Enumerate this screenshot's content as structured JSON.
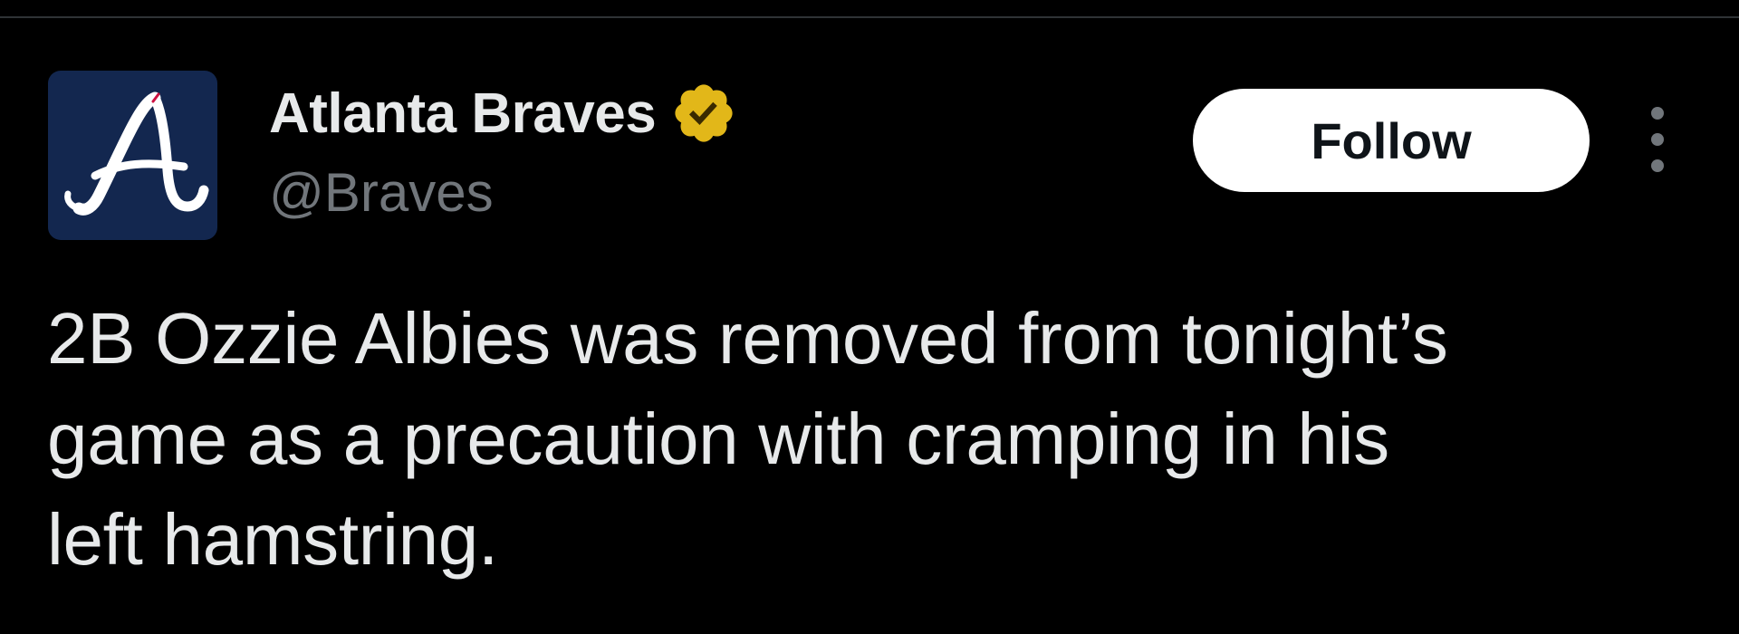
{
  "account": {
    "display_name": "Atlanta Braves",
    "handle": "@Braves",
    "avatar_icon": "braves-a-logo-icon",
    "verified_icon": "gold-verified-badge-icon"
  },
  "actions": {
    "follow_label": "Follow",
    "more_icon": "vertical-ellipsis-icon"
  },
  "tweet": {
    "text": "2B Ozzie Albies was removed from tonight’s\ngame as a precaution with cramping in his\nleft hamstring."
  },
  "colors": {
    "background": "#000000",
    "primary_text": "#e7e9ea",
    "secondary_text": "#71767b",
    "avatar_bg": "#13274f",
    "verified_gold": "#e2b719",
    "follow_bg": "#ffffff"
  }
}
